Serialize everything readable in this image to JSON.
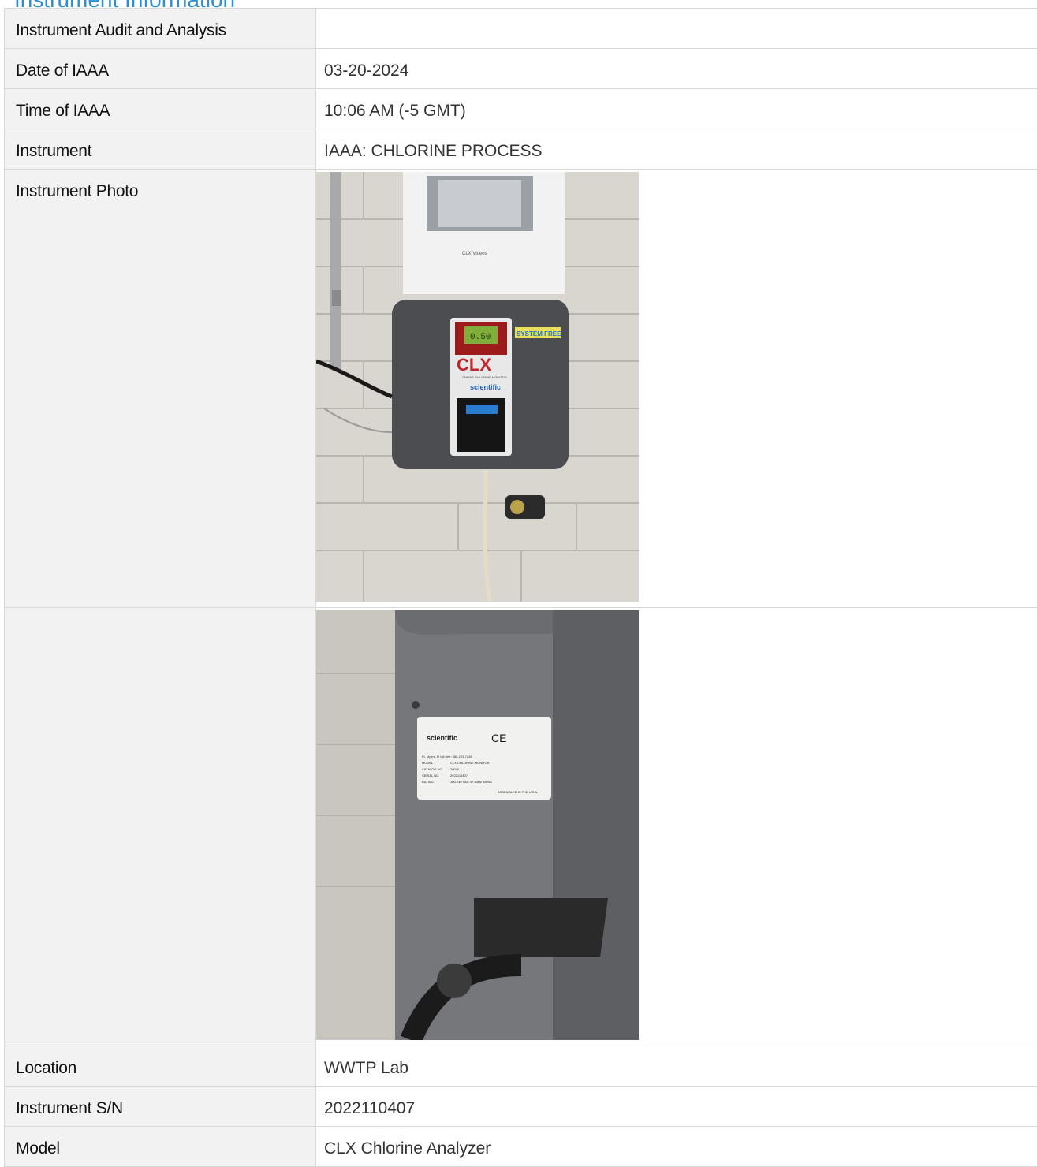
{
  "section_title": "Instrument Information",
  "rows": {
    "audit": {
      "label": "Instrument Audit and Analysis",
      "value": ""
    },
    "date": {
      "label": "Date of IAAA",
      "value": "03-20-2024"
    },
    "time": {
      "label": "Time of IAAA",
      "value": "10:06 AM (-5 GMT)"
    },
    "instrument": {
      "label": "Instrument",
      "value": "IAAA: CHLORINE PROCESS"
    },
    "photo": {
      "label": "Instrument Photo",
      "label2": ""
    },
    "location": {
      "label": "Location",
      "value": "WWTP Lab"
    },
    "serial": {
      "label": "Instrument S/N",
      "value": "2022110407"
    },
    "model": {
      "label": "Model",
      "value": "CLX Chlorine Analyzer"
    }
  },
  "photo1": {
    "display": "CLX",
    "reading": "0.50",
    "brand": "scientific",
    "tag": "SYSTEM FREE",
    "monitor_text": "ONLINE CHLORINE MONITOR",
    "sub_brand": "A WATTS Brand",
    "doc_title": "CLX Videos"
  },
  "photo2": {
    "brand": "scientific",
    "sub_brand": "A WATTS Brand",
    "phone": "Ft. Myers, Fl toll free: 888-203-7248",
    "model_label": "MODEL",
    "model_value": "CLX CHLORINE MONITOR",
    "catalog_label": "CATALOG NO.",
    "catalog_value": "20040",
    "serial_label": "SERIAL NO.",
    "serial_value": "2022110407",
    "rating_label": "RATING",
    "rating_value": "100-240 VAC 47-63Hz 150VA",
    "assembled": "ASSEMBLED IN THE U.S.A.",
    "marks": "CE"
  }
}
